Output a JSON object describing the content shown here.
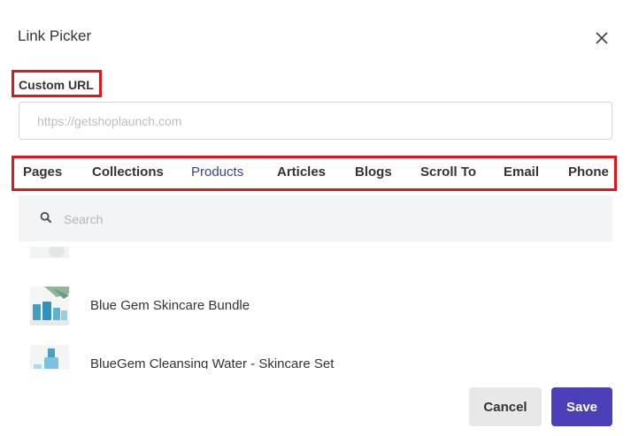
{
  "dialog": {
    "title": "Link Picker"
  },
  "custom_url": {
    "label": "Custom URL",
    "placeholder": "https://getshoplaunch.com",
    "value": ""
  },
  "tabs": [
    {
      "label": "Pages",
      "active": false
    },
    {
      "label": "Collections",
      "active": false
    },
    {
      "label": "Products",
      "active": true
    },
    {
      "label": "Articles",
      "active": false
    },
    {
      "label": "Blogs",
      "active": false
    },
    {
      "label": "Scroll To",
      "active": false
    },
    {
      "label": "Email",
      "active": false
    },
    {
      "label": "Phone",
      "active": false
    }
  ],
  "search": {
    "placeholder": "Search",
    "value": ""
  },
  "products": [
    {
      "label": ""
    },
    {
      "label": "Blue Gem Skincare Bundle"
    },
    {
      "label": "BlueGem Cleansing Water - Skincare Set"
    }
  ],
  "footer": {
    "cancel_label": "Cancel",
    "save_label": "Save"
  },
  "colors": {
    "accent": "#4b40b8",
    "active_tab": "#3c3f9f",
    "highlight_border": "#e5141a"
  }
}
